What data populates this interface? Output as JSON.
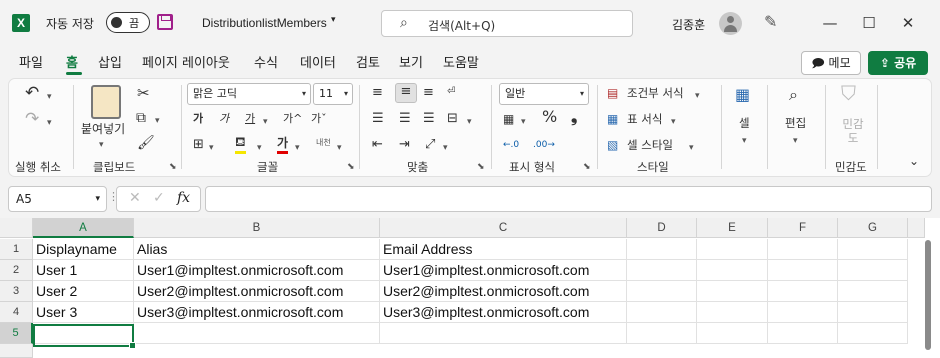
{
  "titlebar": {
    "logo_letter": "X",
    "autosave_label": "자동 저장",
    "autosave_state": "끔",
    "filename": "DistributionlistMembers",
    "search_placeholder": "검색(Alt+Q)",
    "username": "김종훈",
    "window_buttons": {
      "minimize": "—",
      "maximize": "☐",
      "close": "✕"
    }
  },
  "menu": {
    "tabs": [
      "파일",
      "홈",
      "삽입",
      "페이지 레이아웃",
      "수식",
      "데이터",
      "검토",
      "보기",
      "도움말"
    ],
    "active_tab": "홈",
    "memo_label": "메모",
    "share_label": "공유"
  },
  "ribbon": {
    "undo_group_label": "실행 취소",
    "clipboard": {
      "label": "클립보드",
      "paste_label": "붙여넣기"
    },
    "font": {
      "label": "글꼴",
      "font_name": "맑은 고딕",
      "font_size": "11",
      "sizeup_label": "가^",
      "sizedown_label": "가ˇ",
      "bold": "가",
      "italic": "가",
      "underline": "가",
      "strike": "가",
      "phonetic": "내천"
    },
    "alignment": {
      "label": "맞춤"
    },
    "number": {
      "label": "표시 형식",
      "format": "일반"
    },
    "styles": {
      "label": "스타일",
      "conditional": "조건부 서식",
      "table": "표 서식",
      "cell_style": "셀 스타일"
    },
    "cells_label": "셀",
    "editing_label": "편집",
    "sensitivity": {
      "button_label": "민감도",
      "group_label": "민감도"
    }
  },
  "formula_bar": {
    "name_box": "A5",
    "fx": "fx",
    "value": ""
  },
  "grid": {
    "columns": [
      "A",
      "B",
      "C",
      "D",
      "E",
      "F",
      "G"
    ],
    "selected_column": "A",
    "rows": [
      {
        "num": "1",
        "cells": [
          "Displayname",
          "Alias",
          "Email Address"
        ]
      },
      {
        "num": "2",
        "cells": [
          "User 1",
          "User1@impltest.onmicrosoft.com",
          "User1@impltest.onmicrosoft.com"
        ]
      },
      {
        "num": "3",
        "cells": [
          "User 2",
          "User2@impltest.onmicrosoft.com",
          "User2@impltest.onmicrosoft.com"
        ]
      },
      {
        "num": "4",
        "cells": [
          "User 3",
          "User3@impltest.onmicrosoft.com",
          "User3@impltest.onmicrosoft.com"
        ]
      },
      {
        "num": "5",
        "cells": [
          "",
          "",
          ""
        ]
      }
    ],
    "selected_row": "5"
  },
  "colors": {
    "accent": "#107c41",
    "save_icon": "#a01f8a"
  }
}
